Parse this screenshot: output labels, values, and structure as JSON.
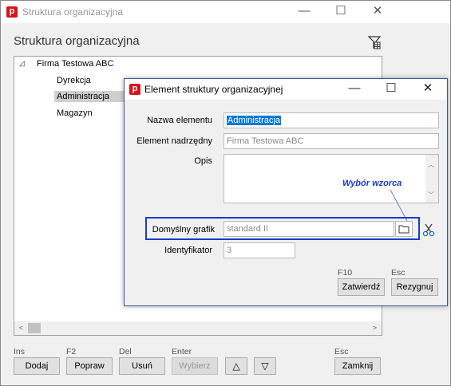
{
  "outer_window": {
    "title": "Struktura organizacyjna",
    "heading": "Struktura organizacyjna",
    "controls": {
      "minimize": "—",
      "maximize": "☐",
      "close": "✕"
    }
  },
  "tree": {
    "root_toggle": "◿",
    "root": "Firma Testowa ABC",
    "children": [
      "Dyrekcja",
      "Administracja",
      "Magazyn"
    ]
  },
  "scroll": {
    "left": "<",
    "right": ">"
  },
  "toolbar": {
    "add": {
      "key": "Ins",
      "label": "Dodaj"
    },
    "edit": {
      "key": "F2",
      "label": "Popraw"
    },
    "delete": {
      "key": "Del",
      "label": "Usuń"
    },
    "choose": {
      "key": "Enter",
      "label": "Wybierz"
    },
    "up_label": "△",
    "down_label": "▽",
    "close": {
      "key": "Esc",
      "label": "Zamknij"
    }
  },
  "dialog": {
    "title": "Element struktury organizacyjnej",
    "controls": {
      "minimize": "—",
      "maximize": "☐",
      "close": "✕"
    },
    "fields": {
      "name": {
        "label": "Nazwa elementu",
        "value": "Administracja"
      },
      "parent": {
        "label": "Element nadrzędny",
        "value": "Firma Testowa ABC"
      },
      "description": {
        "label": "Opis",
        "value": ""
      },
      "schedule": {
        "label": "Domyślny grafik",
        "value": "standard II"
      },
      "identifier": {
        "label": "Identyfikator",
        "value": "3"
      }
    },
    "annotation": "Wybór wzorca",
    "confirm": {
      "key": "F10",
      "label": "Zatwierdź"
    },
    "cancel": {
      "key": "Esc",
      "label": "Rezygnuj"
    }
  },
  "colors": {
    "accent": "#d7141a",
    "highlight": "#1a3cc8",
    "selection": "#0078d7"
  }
}
